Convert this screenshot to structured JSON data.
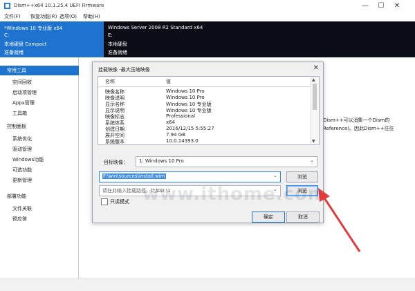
{
  "window": {
    "title": "Dism++x64 10.1.25.4 UEFI Firmware"
  },
  "menubar": {
    "items": [
      "文件(F)",
      "恢复功能(R)",
      "选项(O)",
      "帮助(H)"
    ]
  },
  "image_table": {
    "left": {
      "name": "*Windows 10 专业版 x64",
      "drive": "C:",
      "type": "本地硬盘 Compact",
      "status": "准备就绪"
    },
    "right": {
      "name": "Windows Server 2008 R2 Standard x64",
      "drive": "E:",
      "type": "本地硬盘",
      "status": "准备就绪"
    }
  },
  "sidebar": {
    "items": [
      {
        "label": "常用工具",
        "selected": true,
        "level": 0
      },
      {
        "label": "空间回收",
        "selected": false,
        "level": 1
      },
      {
        "label": "启动项管理",
        "selected": false,
        "level": 1
      },
      {
        "label": "Appx管理",
        "selected": false,
        "level": 1
      },
      {
        "label": "工具箱",
        "selected": false,
        "level": 1
      },
      {
        "label": "控制面板",
        "selected": false,
        "level": 0
      },
      {
        "label": "系统优化",
        "selected": false,
        "level": 1
      },
      {
        "label": "驱动管理",
        "selected": false,
        "level": 1
      },
      {
        "label": "Windows功能",
        "selected": false,
        "level": 1
      },
      {
        "label": "可选功能",
        "selected": false,
        "level": 1
      },
      {
        "label": "更新管理",
        "selected": false,
        "level": 1
      },
      {
        "label": "部署功能",
        "selected": false,
        "level": 0
      },
      {
        "label": "文件关联",
        "selected": false,
        "level": 1
      },
      {
        "label": "预应答",
        "selected": false,
        "level": 1
      }
    ]
  },
  "background_text": {
    "line1": "Dism++可以消集一个Dism的",
    "line2": "Reference)。因此Dism++往往"
  },
  "dialog": {
    "title": "挂载映像 -最大压缩映像",
    "list": {
      "headers": {
        "name": "名称",
        "value": "值"
      },
      "rows": [
        {
          "name": "映像名称",
          "value": "Windows 10 Pro"
        },
        {
          "name": "映像说明",
          "value": "Windows 10 Pro"
        },
        {
          "name": "显示名称",
          "value": "Windows 10 专业版"
        },
        {
          "name": "显示说明",
          "value": "Windows 10 专业版"
        },
        {
          "name": "映像标志",
          "value": "Professional"
        },
        {
          "name": "系统体系",
          "value": "x64"
        },
        {
          "name": "创建日期",
          "value": "2016/12/15 5:55:27"
        },
        {
          "name": "展开空间",
          "value": "7.94 GB"
        },
        {
          "name": "系统版本",
          "value": "10.0.14393.0"
        }
      ]
    },
    "target_image": {
      "label": "目标映像：",
      "value": "1: Windows 10 Pro"
    },
    "path_input": {
      "value": "F:\\win\\sources\\install.wim",
      "browse_label": "浏览"
    },
    "mount_input": {
      "placeholder": "请在此输入挂载路径，比如D:\\1",
      "browse_label": "浏览"
    },
    "readonly": {
      "label": "只读模式",
      "checked": false
    },
    "ok_label": "确定",
    "cancel_label": "取消"
  },
  "watermark": {
    "text": "www.ithome.com"
  },
  "colors": {
    "accent": "#1e73cf",
    "header_dark": "#0a0d16",
    "arrow": "#e23b3b"
  }
}
